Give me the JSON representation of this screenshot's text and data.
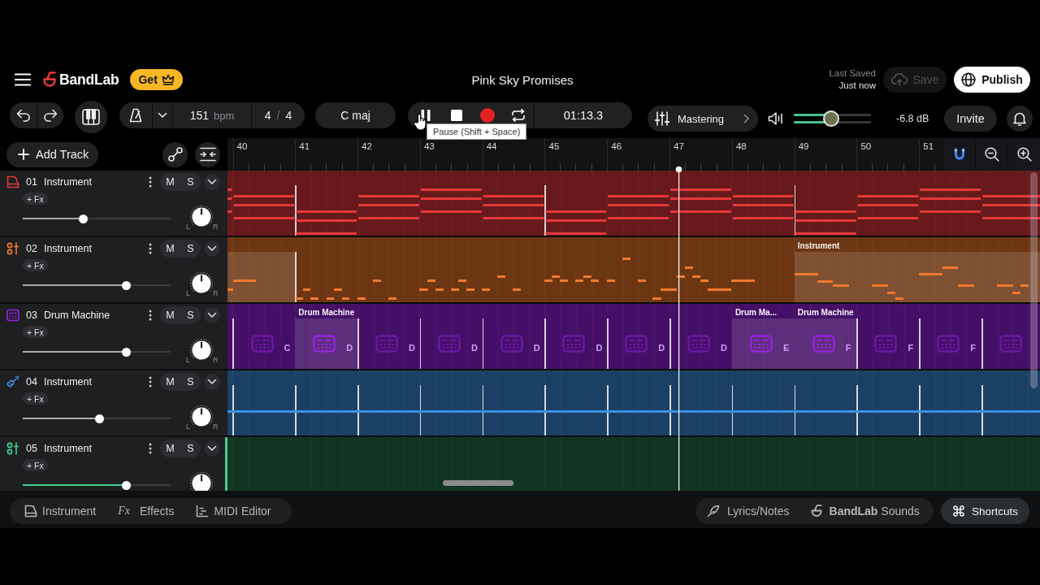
{
  "header": {
    "logo": "BandLab",
    "upgrade_button": "Get",
    "project_title": "Pink Sky Promises",
    "save_status": {
      "label": "Last Saved",
      "time": "Just now"
    },
    "save_button": {
      "label": "Save",
      "disabled": true
    },
    "publish_button": "Publish"
  },
  "toolbar": {
    "tempo": {
      "value": "151",
      "unit": "bpm"
    },
    "time_signature": {
      "beats": "4",
      "separator": "/",
      "note_value": "4"
    },
    "key": "C maj",
    "transport": {
      "playing": true,
      "time": "01:13.3"
    },
    "mastering": "Mastering",
    "master_volume": {
      "level": 0.48,
      "reading": "-6.8 dB"
    },
    "invite_button": "Invite"
  },
  "tooltip": "Pause (Shift + Space)",
  "track_tools": {
    "add_track": "Add Track"
  },
  "timeline": {
    "bars": [
      "40",
      "41",
      "42",
      "43",
      "44",
      "45",
      "46",
      "47",
      "48",
      "49",
      "50",
      "51"
    ],
    "snap": {
      "on": true
    }
  },
  "tracks": [
    {
      "number": "01",
      "name": "Instrument",
      "kind": "keys",
      "color": "#e5383b",
      "selected": false,
      "fx_button": "+ Fx",
      "mute": {
        "label": "M",
        "on": false
      },
      "solo": {
        "label": "S",
        "on": false
      },
      "volume": {
        "level": 0.41
      },
      "pan_labels": {
        "left": "L",
        "right": "R"
      },
      "lane": {
        "kind": "midi",
        "cells": [
          {
            "kind": "plain"
          },
          {
            "kind": "repeat"
          },
          {
            "kind": "plain"
          },
          {
            "kind": "plain"
          },
          {
            "kind": "plain"
          },
          {
            "kind": "repeat"
          },
          {
            "kind": "plain"
          },
          {
            "kind": "plain"
          },
          {
            "kind": "plain"
          },
          {
            "kind": "repeat"
          },
          {
            "kind": "plain"
          },
          {
            "kind": "plain"
          },
          {
            "kind": "plain"
          }
        ]
      }
    },
    {
      "number": "02",
      "name": "Instrument",
      "kind": "synth",
      "color": "#f2792b",
      "selected": false,
      "fx_button": "+ Fx",
      "mute": {
        "label": "M",
        "on": false
      },
      "solo": {
        "label": "S",
        "on": false
      },
      "volume": {
        "level": 0.7
      },
      "pan_labels": {
        "left": "L",
        "right": "R"
      },
      "lane": {
        "kind": "midi",
        "cells": [
          {
            "kind": "clip"
          },
          {
            "kind": "repeat"
          },
          {
            "kind": "plain"
          },
          {
            "kind": "plain"
          },
          {
            "kind": "plain"
          },
          {
            "kind": "plain"
          },
          {
            "kind": "plain"
          },
          {
            "kind": "plain"
          },
          {
            "kind": "plain"
          },
          {
            "kind": "clip",
            "label": "Instrument"
          },
          {
            "kind": "clip"
          },
          {
            "kind": "clip"
          },
          {
            "kind": "clip"
          }
        ]
      }
    },
    {
      "number": "03",
      "name": "Drum Machine",
      "kind": "drum_machine",
      "color": "#9a22e6",
      "selected": false,
      "fx_button": "+ Fx",
      "mute": {
        "label": "M",
        "on": false
      },
      "solo": {
        "label": "S",
        "on": false
      },
      "volume": {
        "level": 0.7
      },
      "pan_labels": {
        "left": "L",
        "right": "R"
      },
      "lane": {
        "kind": "drums",
        "cells": [
          {
            "kind": "repeat",
            "pattern": "C"
          },
          {
            "kind": "clip",
            "label": "Drum Machine",
            "pattern": "D"
          },
          {
            "kind": "repeat",
            "pattern": "D"
          },
          {
            "kind": "repeat",
            "pattern": "D"
          },
          {
            "kind": "repeat",
            "pattern": "D"
          },
          {
            "kind": "repeat",
            "pattern": "D"
          },
          {
            "kind": "repeat",
            "pattern": "D"
          },
          {
            "kind": "repeat",
            "pattern": "D"
          },
          {
            "kind": "clip",
            "label": "Drum Ma...",
            "pattern": "E"
          },
          {
            "kind": "clip",
            "label": "Drum Machine",
            "pattern": "F"
          },
          {
            "kind": "repeat",
            "pattern": "F"
          },
          {
            "kind": "repeat",
            "pattern": "F"
          },
          {
            "kind": "repeat"
          }
        ]
      }
    },
    {
      "number": "04",
      "name": "Instrument",
      "kind": "guitar",
      "color": "#3d8fe0",
      "selected": false,
      "fx_button": "+ Fx",
      "mute": {
        "label": "M",
        "on": false
      },
      "solo": {
        "label": "S",
        "on": false
      },
      "volume": {
        "level": 0.52
      },
      "pan_labels": {
        "left": "L",
        "right": "R"
      },
      "lane": {
        "kind": "audio",
        "cells": [
          {
            "kind": "repeat"
          },
          {
            "kind": "repeat"
          },
          {
            "kind": "repeat"
          },
          {
            "kind": "repeat"
          },
          {
            "kind": "repeat"
          },
          {
            "kind": "repeat"
          },
          {
            "kind": "repeat"
          },
          {
            "kind": "repeat"
          },
          {
            "kind": "repeat"
          },
          {
            "kind": "repeat"
          },
          {
            "kind": "repeat"
          },
          {
            "kind": "repeat"
          },
          {
            "kind": "repeat"
          }
        ]
      }
    },
    {
      "number": "05",
      "name": "Instrument",
      "kind": "synth",
      "color": "#3fd28a",
      "selected": true,
      "fx_button": "+ Fx",
      "mute": {
        "label": "M",
        "on": false
      },
      "solo": {
        "label": "S",
        "on": false
      },
      "volume": {
        "level": 0.7
      },
      "lane": {
        "kind": "empty"
      }
    }
  ],
  "bottom_bar": {
    "left": [
      {
        "kind": "instrument",
        "label": "Instrument"
      },
      {
        "kind": "effects",
        "symbol": "Fx",
        "label": "Effects"
      },
      {
        "kind": "midi",
        "label": "MIDI Editor"
      }
    ],
    "right": [
      {
        "kind": "lyrics",
        "label": "Lyrics/Notes"
      },
      {
        "kind": "sounds",
        "label": "**BandLab** Sounds"
      }
    ],
    "shortcuts": "Shortcuts"
  }
}
